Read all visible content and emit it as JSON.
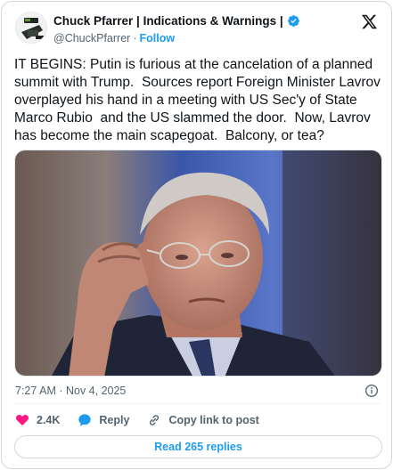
{
  "author": {
    "display_name": "Chuck Pfarrer | Indications & Warnings |",
    "handle": "@ChuckPfarrer",
    "separator": "·",
    "follow_label": "Follow"
  },
  "tweet": {
    "text": "IT BEGINS: Putin is furious at the cancelation of a planned summit with Trump.  Sources report Foreign Minister Lavrov overplayed his hand in a meeting with US Sec'y of State Marco Rubio  and the US slammed the door.  Now, Lavrov has become the main scapegoat.  Balcony, or tea?",
    "timestamp": "7:27 AM · Nov 4, 2025"
  },
  "actions": {
    "like_count": "2.4K",
    "reply_label": "Reply",
    "copy_label": "Copy link to post",
    "read_replies_label": "Read 265 replies"
  },
  "icons": {
    "brand": "x-logo-icon",
    "verified": "verified-badge-icon",
    "info": "info-icon",
    "like": "heart-icon",
    "reply": "reply-bubble-icon",
    "copy": "link-icon"
  },
  "colors": {
    "accent": "#1d9bf0",
    "like": "#f91880",
    "muted": "#536471",
    "text": "#0f1419"
  }
}
